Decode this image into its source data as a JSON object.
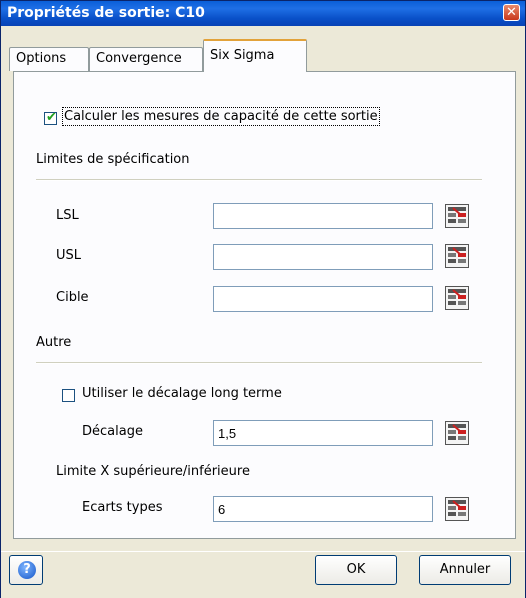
{
  "window": {
    "title": "Propriétés de sortie: C10",
    "close_glyph": "✕"
  },
  "tabs": [
    {
      "label": "Options"
    },
    {
      "label": "Convergence"
    },
    {
      "label": "Six Sigma"
    }
  ],
  "six_sigma": {
    "calc_checkbox": {
      "checked": true,
      "label": "Calculer les mesures de capacité de cette sortie"
    },
    "spec_limits_heading": "Limites de spécification",
    "lsl": {
      "label": "LSL",
      "value": ""
    },
    "usl": {
      "label": "USL",
      "value": ""
    },
    "cible": {
      "label": "Cible",
      "value": ""
    },
    "autre_heading": "Autre",
    "long_term_checkbox": {
      "checked": false,
      "label": "Utiliser le décalage long terme"
    },
    "decalage": {
      "label": "Décalage",
      "value": "1,5"
    },
    "limite_x_heading": "Limite X supérieure/inférieure",
    "ecarts": {
      "label": "Ecarts types",
      "value": "6"
    }
  },
  "footer": {
    "ok_label": "OK",
    "cancel_label": "Annuler"
  }
}
